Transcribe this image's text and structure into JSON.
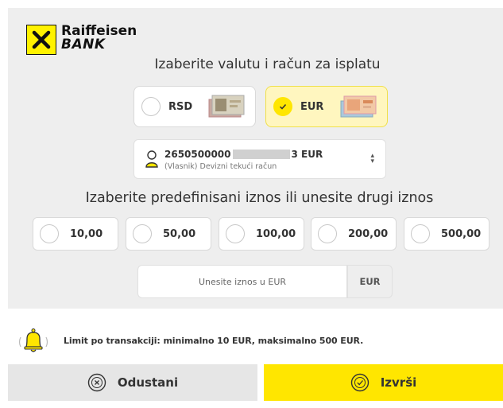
{
  "brand": {
    "line1": "Raiffeisen",
    "line2": "BANK"
  },
  "currency_section": {
    "title": "Izaberite valutu i račun za isplatu",
    "options": [
      {
        "label": "RSD",
        "selected": false,
        "icon": "banknote-rsd-icon"
      },
      {
        "label": "EUR",
        "selected": true,
        "icon": "banknote-eur-icon"
      }
    ]
  },
  "account": {
    "number_start": "2650500000",
    "number_end": "3 EUR",
    "type": "(Vlasnik) Devizni tekući račun"
  },
  "amount_section": {
    "title": "Izaberite predefinisani iznos ili unesite drugi iznos",
    "amounts": [
      "10,00",
      "50,00",
      "100,00",
      "200,00",
      "500,00"
    ],
    "input_placeholder": "Unesite iznos u EUR",
    "input_currency": "EUR"
  },
  "limit_text": "Limit po transakciji: minimalno 10 EUR, maksimalno 500 EUR.",
  "actions": {
    "cancel": "Odustani",
    "confirm": "Izvrši"
  },
  "colors": {
    "accent": "#ffe600",
    "panel": "#eeeeee"
  }
}
